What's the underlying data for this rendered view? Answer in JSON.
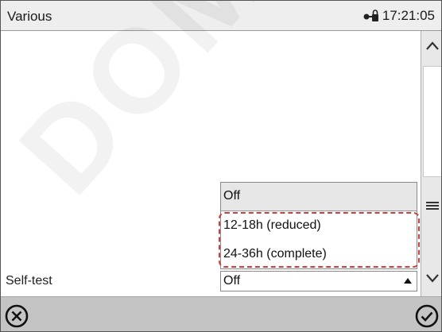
{
  "header": {
    "title": "Various",
    "time": "17:21:05",
    "lock_icon": "lock-key-icon"
  },
  "watermark": {
    "text": "DOMINI"
  },
  "dropdown": {
    "options": [
      "Off",
      "12-18h (reduced)",
      "24-36h (complete)"
    ],
    "selected_index": 0
  },
  "setting": {
    "label": "Self-test",
    "value": "Off"
  },
  "scrollbar": {
    "up_icon": "chevron-up-icon",
    "menu_icon": "menu-icon",
    "down_icon": "chevron-down-icon"
  },
  "footer": {
    "cancel_icon": "cancel-circle-icon",
    "confirm_icon": "confirm-check-icon"
  },
  "colors": {
    "header_bg": "#eeeeee",
    "footer_bg": "#c4c4c4",
    "highlight": "#d23c3c"
  }
}
